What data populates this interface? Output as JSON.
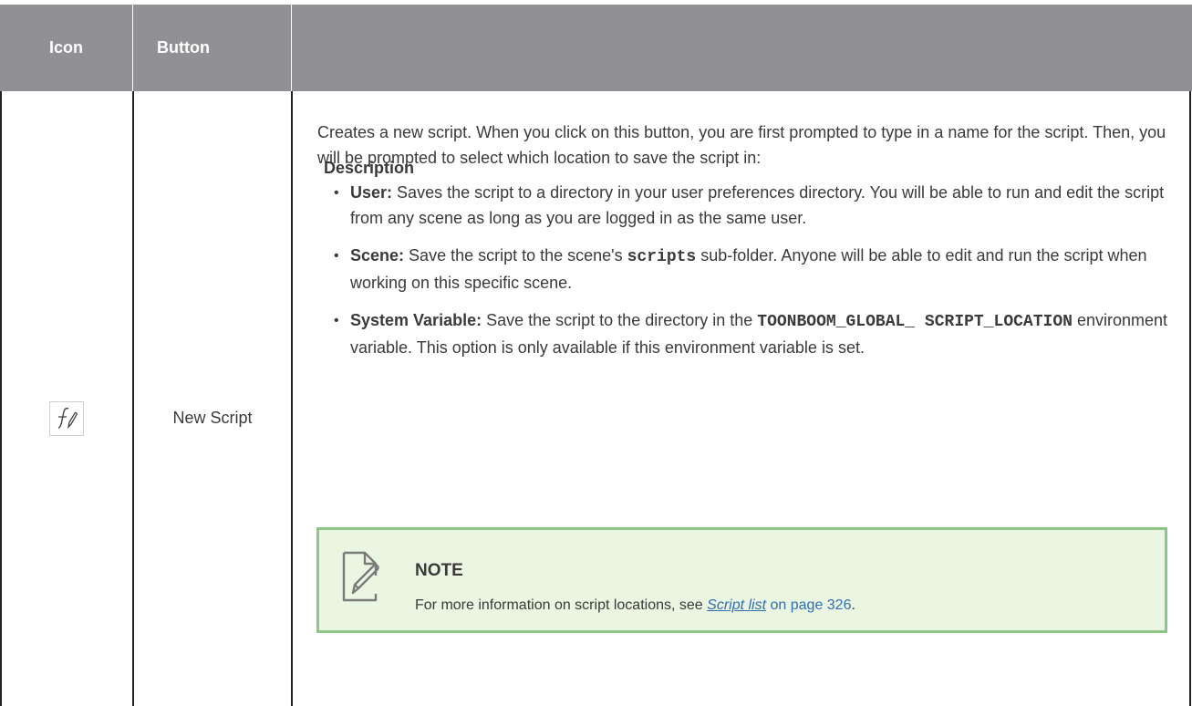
{
  "table": {
    "headers": {
      "icon": "Icon",
      "button": "Button",
      "description": "Description"
    },
    "row": {
      "icon": "new-script-icon",
      "button": "New Script",
      "intro": "Creates a new script. When you click on this button, you are first prompted to type in a name for the script. Then, you will be prompted to select which location to save the script in:",
      "options": [
        {
          "label": "User:",
          "text": "Saves the script to a directory in your user preferences directory. You will be able to run and edit the script from any scene as long as you are logged in as the same user."
        },
        {
          "label": "Scene:",
          "pre": "Save the script to the scene's",
          "code": "scripts",
          "post": "sub-folder. Anyone will be able to edit and run the script when working on this specific scene."
        },
        {
          "label": "System Variable:",
          "pre": "Save the script to the directory in the",
          "code": "TOONBOOM_GLOBAL_ SCRIPT_LOCATION",
          "post": "environment variable. This option is only available if this environment variable is set."
        }
      ],
      "note": {
        "title": "NOTE",
        "text_pre": "For more information on script locations, see",
        "link": "Script list",
        "link_suffix": "on page 326",
        "text_post": "."
      }
    }
  },
  "colors": {
    "header_bg": "#919195",
    "note_bg": "#ebf6e2",
    "note_border": "#8fc48a",
    "link": "#2f6fb3"
  }
}
